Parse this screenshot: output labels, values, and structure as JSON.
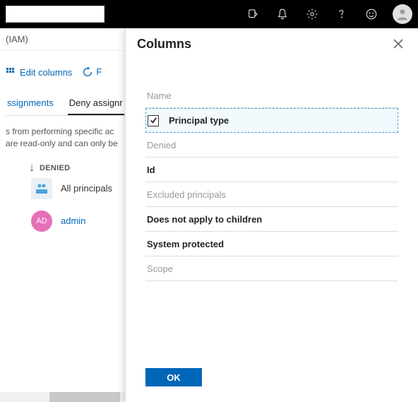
{
  "breadcrumb": {
    "text": "(IAM)"
  },
  "toolbar": {
    "edit_columns": "Edit columns",
    "refresh_fragment": "F"
  },
  "tabs": {
    "role_assignments": "ssignments",
    "deny_assignments": "Deny assignr"
  },
  "description": {
    "line1": "s from performing specific ac",
    "line2": "are read-only and can only be"
  },
  "column_header": "DENIED",
  "rows": {
    "all_principals": {
      "label": "All principals"
    },
    "admin": {
      "badge": "AD",
      "label": "admin"
    }
  },
  "panel": {
    "title": "Columns",
    "columns": [
      {
        "label": "Name",
        "selected": false,
        "active": false
      },
      {
        "label": "Principal type",
        "selected": true,
        "active": true
      },
      {
        "label": "Denied",
        "selected": false,
        "active": false
      },
      {
        "label": "Id",
        "selected": false,
        "active": true
      },
      {
        "label": "Excluded principals",
        "selected": false,
        "active": false
      },
      {
        "label": "Does not apply to children",
        "selected": false,
        "active": true
      },
      {
        "label": "System protected",
        "selected": false,
        "active": true
      },
      {
        "label": "Scope",
        "selected": false,
        "active": false
      }
    ],
    "ok": "OK"
  }
}
